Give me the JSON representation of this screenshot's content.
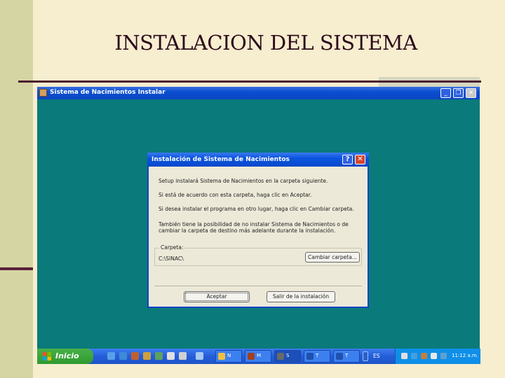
{
  "slide": {
    "title": "INSTALACION DEL SISTEMA"
  },
  "window": {
    "title": "Sistema de Nacimientos Instalar",
    "minimize_glyph": "_",
    "restore_glyph": "❐",
    "close_glyph": "✕"
  },
  "dialog": {
    "title": "Instalación de Sistema de Nacimientos",
    "help_glyph": "?",
    "close_glyph": "✕",
    "paragraphs": [
      "Setup instalará Sistema de Nacimientos en la carpeta siguiente.",
      "Si está de acuerdo con esta carpeta, haga clic en Aceptar.",
      "Si desea instalar el programa en otro lugar, haga clic en Cambiar carpeta.",
      "También tiene la posibilidad de no instalar Sistema de Nacimientos o de cambiar la carpeta de destino más adelante durante la instalación."
    ],
    "folder_legend": "Carpeta:",
    "folder_value": "C:\\SINAC\\",
    "change_folder_button": "Cambiar carpeta...",
    "ok_button": "Aceptar",
    "exit_button": "Salir de la instalación"
  },
  "taskbar": {
    "start_label": "Inicio",
    "tasks": [
      {
        "icon": "folder-icon",
        "label": "N",
        "color": "#f0c040"
      },
      {
        "icon": "app-icon",
        "label": "M",
        "color": "#a04020"
      },
      {
        "icon": "setup-icon",
        "label": "S",
        "color": "#6a6a6a"
      },
      {
        "icon": "word-icon",
        "label": "T",
        "color": "#2050b0"
      },
      {
        "icon": "word-icon",
        "label": "T",
        "color": "#2050b0"
      }
    ],
    "language": "ES",
    "clock": "11:12 a.m."
  },
  "colors": {
    "desktop": "#0a7a7a",
    "title_bar": "#0a4fd0",
    "dialog_face": "#ece9d8",
    "slide_background": "#f7edcf"
  }
}
